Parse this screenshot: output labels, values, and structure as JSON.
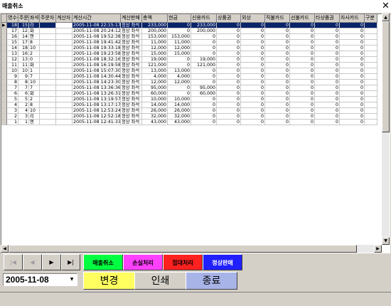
{
  "window": {
    "title": "매출취소",
    "close_glyph": "✕"
  },
  "columns": [
    "영수증",
    "주문번호",
    "좌석",
    "주문자",
    "계산자",
    "계산시간",
    "계산판매",
    "총액",
    "현금",
    "신용카드",
    "상품권",
    "외상",
    "직불카드",
    "선불카드",
    "타상품권",
    "자사카드",
    "구분"
  ],
  "rows": [
    {
      "no": "18",
      "order": "15",
      "seat": "라",
      "orderer": "",
      "payer": "",
      "time": "2005-11-08 22:15:17",
      "type": "정상 좌석",
      "total": "233,000",
      "cash": "0",
      "credit": "233,000",
      "gift": "0",
      "credit_ext": "0",
      "debit": "0",
      "prepaid": "0",
      "other_gift": "0",
      "own_card": "0",
      "selected": true
    },
    {
      "no": "17",
      "order": "12",
      "seat": "화",
      "orderer": "",
      "payer": "",
      "time": "2005-11-08 20:24:12",
      "type": "정상 좌석",
      "total": "200,000",
      "cash": "0",
      "credit": "200,000",
      "gift": "0",
      "credit_ext": "0",
      "debit": "0",
      "prepaid": "0",
      "other_gift": "0",
      "own_card": "0"
    },
    {
      "no": "16",
      "order": "14",
      "seat": "엔",
      "orderer": "",
      "payer": "",
      "time": "2005-11-08 19:52:38",
      "type": "정상 좌석",
      "total": "153,000",
      "cash": "153,000",
      "credit": "0",
      "gift": "0",
      "credit_ext": "0",
      "debit": "0",
      "prepaid": "0",
      "other_gift": "0",
      "own_card": "0"
    },
    {
      "no": "15",
      "order": "17",
      "seat": "8",
      "orderer": "",
      "payer": "",
      "time": "2005-11-08 19:41:42",
      "type": "정상 좌석",
      "total": "11,000",
      "cash": "11,000",
      "credit": "0",
      "gift": "0",
      "credit_ext": "0",
      "debit": "0",
      "prepaid": "0",
      "other_gift": "0",
      "own_card": "0"
    },
    {
      "no": "14",
      "order": "18",
      "seat": "10",
      "orderer": "",
      "payer": "",
      "time": "2005-11-08 19:33:18",
      "type": "정상 좌석",
      "total": "12,000",
      "cash": "12,000",
      "credit": "0",
      "gift": "0",
      "credit_ext": "0",
      "debit": "0",
      "prepaid": "0",
      "other_gift": "0",
      "own_card": "0"
    },
    {
      "no": "13",
      "order": "16",
      "seat": "2",
      "orderer": "",
      "payer": "",
      "time": "2005-11-08 19:23:58",
      "type": "정상 좌석",
      "total": "15,000",
      "cash": "15,000",
      "credit": "0",
      "gift": "0",
      "credit_ext": "0",
      "debit": "0",
      "prepaid": "0",
      "other_gift": "0",
      "own_card": "0"
    },
    {
      "no": "12",
      "order": "13",
      "seat": "0",
      "orderer": "",
      "payer": "",
      "time": "2005-11-08 18:32:16",
      "type": "정상 좌석",
      "total": "19,000",
      "cash": "0",
      "credit": "19,000",
      "gift": "0",
      "credit_ext": "0",
      "debit": "0",
      "prepaid": "0",
      "other_gift": "0",
      "own_card": "0"
    },
    {
      "no": "11",
      "order": "11",
      "seat": "화",
      "orderer": "",
      "payer": "",
      "time": "2005-11-08 16:19:58",
      "type": "정상 좌석",
      "total": "121,000",
      "cash": "0",
      "credit": "121,000",
      "gift": "0",
      "credit_ext": "0",
      "debit": "0",
      "prepaid": "0",
      "other_gift": "0",
      "own_card": "0"
    },
    {
      "no": "10",
      "order": "10",
      "seat": "1",
      "orderer": "",
      "payer": "",
      "time": "2005-11-08 15:07:30",
      "type": "정상 좌석",
      "total": "13,000",
      "cash": "13,000",
      "credit": "0",
      "gift": "0",
      "credit_ext": "0",
      "debit": "0",
      "prepaid": "0",
      "other_gift": "0",
      "own_card": "0"
    },
    {
      "no": "9",
      "order": "9",
      "seat": "7",
      "orderer": "",
      "payer": "",
      "time": "2005-11-08 14:30:44",
      "type": "정상 좌석",
      "total": "4,000",
      "cash": "4,000",
      "credit": "0",
      "gift": "0",
      "credit_ext": "0",
      "debit": "0",
      "prepaid": "0",
      "other_gift": "0",
      "own_card": "0"
    },
    {
      "no": "8",
      "order": "8",
      "seat": "10",
      "orderer": "",
      "payer": "",
      "time": "2005-11-08 14:23:30",
      "type": "정상 좌석",
      "total": "12,000",
      "cash": "12,000",
      "credit": "0",
      "gift": "0",
      "credit_ext": "0",
      "debit": "0",
      "prepaid": "0",
      "other_gift": "0",
      "own_card": "0"
    },
    {
      "no": "7",
      "order": "7",
      "seat": "7",
      "orderer": "",
      "payer": "",
      "time": "2005-11-08 13:36:36",
      "type": "정상 좌석",
      "total": "95,000",
      "cash": "0",
      "credit": "95,000",
      "gift": "0",
      "credit_ext": "0",
      "debit": "0",
      "prepaid": "0",
      "other_gift": "0",
      "own_card": "0"
    },
    {
      "no": "6",
      "order": "6",
      "seat": "화",
      "orderer": "",
      "payer": "",
      "time": "2005-11-08 13:26:31",
      "type": "정상 좌석",
      "total": "60,000",
      "cash": "0",
      "credit": "60,000",
      "gift": "0",
      "credit_ext": "0",
      "debit": "0",
      "prepaid": "0",
      "other_gift": "0",
      "own_card": "0"
    },
    {
      "no": "5",
      "order": "5",
      "seat": "2",
      "orderer": "",
      "payer": "",
      "time": "2005-11-08 13:19:57",
      "type": "정상 좌석",
      "total": "10,000",
      "cash": "10,000",
      "credit": "0",
      "gift": "0",
      "credit_ext": "0",
      "debit": "0",
      "prepaid": "0",
      "other_gift": "0",
      "own_card": "0"
    },
    {
      "no": "4",
      "order": "2",
      "seat": "8",
      "orderer": "",
      "payer": "",
      "time": "2005-11-08 13:17:17",
      "type": "정상 좌석",
      "total": "14,000",
      "cash": "14,000",
      "credit": "0",
      "gift": "0",
      "credit_ext": "0",
      "debit": "0",
      "prepaid": "0",
      "other_gift": "0",
      "own_card": "0"
    },
    {
      "no": "3",
      "order": "4",
      "seat": "10",
      "orderer": "",
      "payer": "",
      "time": "2005-11-08 12:53:24",
      "type": "정상 좌석",
      "total": "26,000",
      "cash": "26,000",
      "credit": "0",
      "gift": "0",
      "credit_ext": "0",
      "debit": "0",
      "prepaid": "0",
      "other_gift": "0",
      "own_card": "0"
    },
    {
      "no": "2",
      "order": "3",
      "seat": "리",
      "orderer": "",
      "payer": "",
      "time": "2005-11-08 12:52:18",
      "type": "정상 좌석",
      "total": "32,000",
      "cash": "32,000",
      "credit": "0",
      "gift": "0",
      "credit_ext": "0",
      "debit": "0",
      "prepaid": "0",
      "other_gift": "0",
      "own_card": "0"
    },
    {
      "no": "1",
      "order": "1",
      "seat": "엔",
      "orderer": "",
      "payer": "",
      "time": "2005-11-08 12:41:33",
      "type": "정상 좌석",
      "total": "43,000",
      "cash": "43,000",
      "credit": "0",
      "gift": "0",
      "credit_ext": "0",
      "debit": "0",
      "prepaid": "0",
      "other_gift": "0",
      "own_card": "0"
    }
  ],
  "nav": {
    "first": "|◀",
    "prev": "◀",
    "next": "▶",
    "last": "▶|"
  },
  "actions": [
    {
      "label": "매출취소",
      "color": "#00ff40"
    },
    {
      "label": "손실처리",
      "color": "#ff40ff"
    },
    {
      "label": "접대처리",
      "color": "#ff2020"
    },
    {
      "label": "정상판매",
      "color": "#2020ff"
    }
  ],
  "date": {
    "value": "2005-11-08",
    "arrow": "▼"
  },
  "buttons": [
    {
      "label": "변경",
      "color": "#ffff60"
    },
    {
      "label": "인쇄",
      "color": "#d4d0c8"
    },
    {
      "label": "종료",
      "color": "#a8b4e8"
    }
  ],
  "scroll": {
    "up": "▲",
    "down": "▼",
    "left": "◀",
    "right": "▶"
  }
}
